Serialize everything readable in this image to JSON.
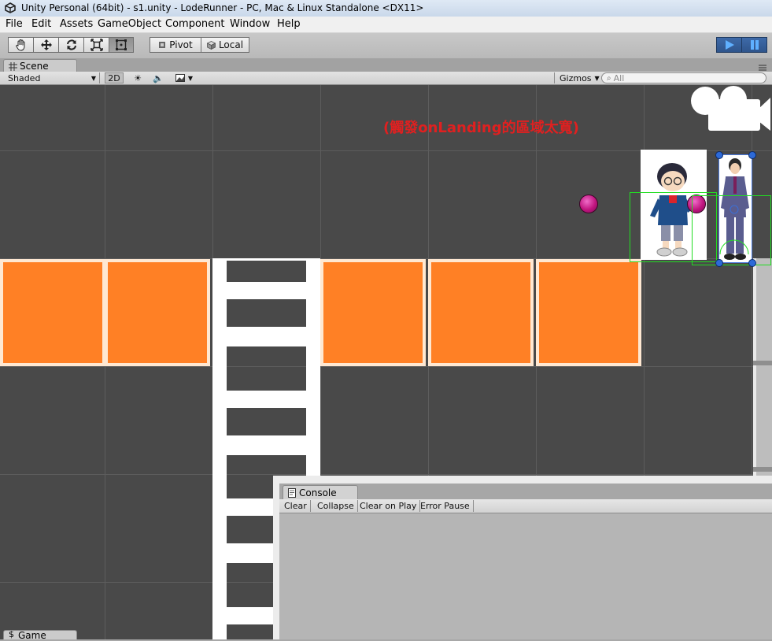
{
  "window": {
    "title": "Unity Personal (64bit) - s1.unity - LodeRunner - PC, Mac & Linux Standalone <DX11>"
  },
  "menu": [
    "File",
    "Edit",
    "Assets",
    "GameObject",
    "Component",
    "Window",
    "Help"
  ],
  "toolbar": {
    "tools": [
      "hand-tool",
      "move-tool",
      "rotate-tool",
      "scale-tool",
      "rect-tool"
    ],
    "pivot_label": "Pivot",
    "local_label": "Local",
    "play_controls": [
      "play",
      "pause"
    ]
  },
  "scene_tab": {
    "label": "Scene"
  },
  "scene_bar": {
    "shading_mode": "Shaded",
    "mode_2d": "2D",
    "gizmos_label": "Gizmos",
    "search_placeholder": "All"
  },
  "scene": {
    "annotation": "(觸發onLanding的區域太寬)",
    "annotation_color": "#e02020",
    "brick_color": "#ff8025"
  },
  "console": {
    "tab_label": "Console",
    "buttons": [
      "Clear",
      "Collapse",
      "Clear on Play",
      "Error Pause"
    ]
  },
  "game_tab": {
    "label": "Game"
  }
}
